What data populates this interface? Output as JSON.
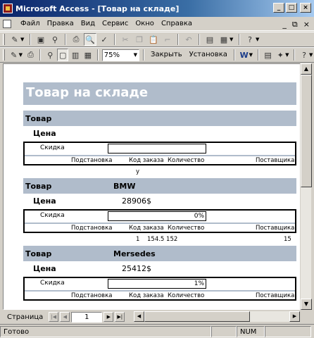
{
  "window": {
    "title": "Microsoft Access - [Товар на складе]",
    "btn_min": "_",
    "btn_max": "□",
    "btn_close": "×"
  },
  "menu": {
    "items": [
      "Файл",
      "Правка",
      "Вид",
      "Сервис",
      "Окно",
      "Справка"
    ],
    "right": [
      "_",
      "⧉",
      "×"
    ]
  },
  "toolbar2": {
    "zoom": "75%",
    "close_label": "Закрыть",
    "setup_label": "Установка"
  },
  "report": {
    "title": "Товар на складе",
    "labels": {
      "product": "Товар",
      "price": "Цена",
      "discount": "Скидка",
      "sub_headers": [
        "Подстановка",
        "Код заказа",
        "Количество",
        "Поставщика"
      ]
    },
    "sections": [
      {
        "product": "",
        "price": "",
        "discount": "",
        "detail": [
          "у",
          "",
          ""
        ]
      },
      {
        "product": "BMW",
        "price": "28906$",
        "discount": "0%",
        "detail": [
          "1",
          "154.5 152",
          "15"
        ]
      },
      {
        "product": "Mersedes",
        "price": "25412$",
        "discount": "1%",
        "detail": [
          "",
          "",
          ""
        ]
      }
    ]
  },
  "nav": {
    "label": "Страница",
    "page": "1"
  },
  "status": {
    "text": "Готово",
    "num": "NUM"
  }
}
